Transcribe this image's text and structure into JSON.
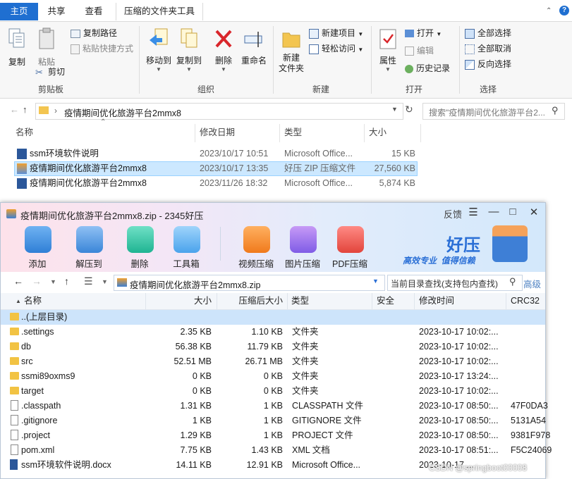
{
  "explorer": {
    "tabs": [
      "主页",
      "共享",
      "查看",
      "压缩的文件夹工具"
    ],
    "ribbon": {
      "copy": "复制",
      "paste": "粘贴",
      "copy_path": "复制路径",
      "paste_shortcut": "粘贴快捷方式",
      "cut": "剪切",
      "group_clipboard": "剪贴板",
      "move_to": "移动到",
      "copy_to": "复制到",
      "delete": "删除",
      "rename": "重命名",
      "group_organize": "组织",
      "new_folder": "新建\n文件夹",
      "new_item": "新建项目",
      "easy_access": "轻松访问",
      "group_new": "新建",
      "properties": "属性",
      "open": "打开",
      "edit": "编辑",
      "history": "历史记录",
      "group_open": "打开",
      "select_all": "全部选择",
      "select_none": "全部取消",
      "invert": "反向选择",
      "group_select": "选择"
    },
    "address": "疫情期间优化旅游平台2mmx8",
    "search_placeholder": "搜索\"疫情期间优化旅游平台2...",
    "columns": [
      "名称",
      "修改日期",
      "类型",
      "大小"
    ],
    "files": [
      {
        "name": "ssm环境软件说明",
        "date": "2023/10/17 10:51",
        "type": "Microsoft Office...",
        "size": "15 KB"
      },
      {
        "name": "疫情期间优化旅游平台2mmx8",
        "date": "2023/10/17 13:35",
        "type": "好压 ZIP 压缩文件",
        "size": "27,560 KB"
      },
      {
        "name": "疫情期间优化旅游平台2mmx8",
        "date": "2023/11/26 18:32",
        "type": "Microsoft Office...",
        "size": "5,874 KB"
      }
    ]
  },
  "haozip": {
    "title": "疫情期间优化旅游平台2mmx8.zip - 2345好压",
    "feedback": "反馈",
    "tools": [
      "添加",
      "解压到",
      "删除",
      "工具箱",
      "视频压缩",
      "图片压缩",
      "PDF压缩"
    ],
    "brand": "好压",
    "slogan": "高效专业  值得信赖",
    "path": "疫情期间优化旅游平台2mmx8.zip",
    "search_placeholder": "当前目录查找(支持包内查找)",
    "advanced": "高级",
    "columns": [
      "名称",
      "大小",
      "压缩后大小",
      "类型",
      "安全",
      "修改时间",
      "CRC32"
    ],
    "rows": [
      {
        "name": "..(上层目录)",
        "size": "",
        "packed": "",
        "type": "",
        "time": "",
        "crc": "",
        "kind": "folder"
      },
      {
        "name": ".settings",
        "size": "2.35 KB",
        "packed": "1.10 KB",
        "type": "文件夹",
        "time": "2023-10-17 10:02:...",
        "crc": "",
        "kind": "folder"
      },
      {
        "name": "db",
        "size": "56.38 KB",
        "packed": "11.79 KB",
        "type": "文件夹",
        "time": "2023-10-17 10:02:...",
        "crc": "",
        "kind": "folder"
      },
      {
        "name": "src",
        "size": "52.51 MB",
        "packed": "26.71 MB",
        "type": "文件夹",
        "time": "2023-10-17 10:02:...",
        "crc": "",
        "kind": "folder"
      },
      {
        "name": "ssmi89oxms9",
        "size": "0 KB",
        "packed": "0 KB",
        "type": "文件夹",
        "time": "2023-10-17 13:24:...",
        "crc": "",
        "kind": "folder"
      },
      {
        "name": "target",
        "size": "0 KB",
        "packed": "0 KB",
        "type": "文件夹",
        "time": "2023-10-17 10:02:...",
        "crc": "",
        "kind": "folder"
      },
      {
        "name": ".classpath",
        "size": "1.31 KB",
        "packed": "1 KB",
        "type": "CLASSPATH 文件",
        "time": "2023-10-17 08:50:...",
        "crc": "47F0DA3",
        "kind": "file"
      },
      {
        "name": ".gitignore",
        "size": "1 KB",
        "packed": "1 KB",
        "type": "GITIGNORE 文件",
        "time": "2023-10-17 08:50:...",
        "crc": "5131A54",
        "kind": "file"
      },
      {
        "name": ".project",
        "size": "1.29 KB",
        "packed": "1 KB",
        "type": "PROJECT 文件",
        "time": "2023-10-17 08:50:...",
        "crc": "9381F978",
        "kind": "file"
      },
      {
        "name": "pom.xml",
        "size": "7.75 KB",
        "packed": "1.43 KB",
        "type": "XML 文档",
        "time": "2023-10-17 08:51:...",
        "crc": "F5C24069",
        "kind": "file"
      },
      {
        "name": "ssm环境软件说明.docx",
        "size": "14.11 KB",
        "packed": "12.91 KB",
        "type": "Microsoft Office...",
        "time": "2023-10-17 ...",
        "crc": "",
        "kind": "word"
      }
    ],
    "watermark": "CSDN @springboot00008"
  }
}
